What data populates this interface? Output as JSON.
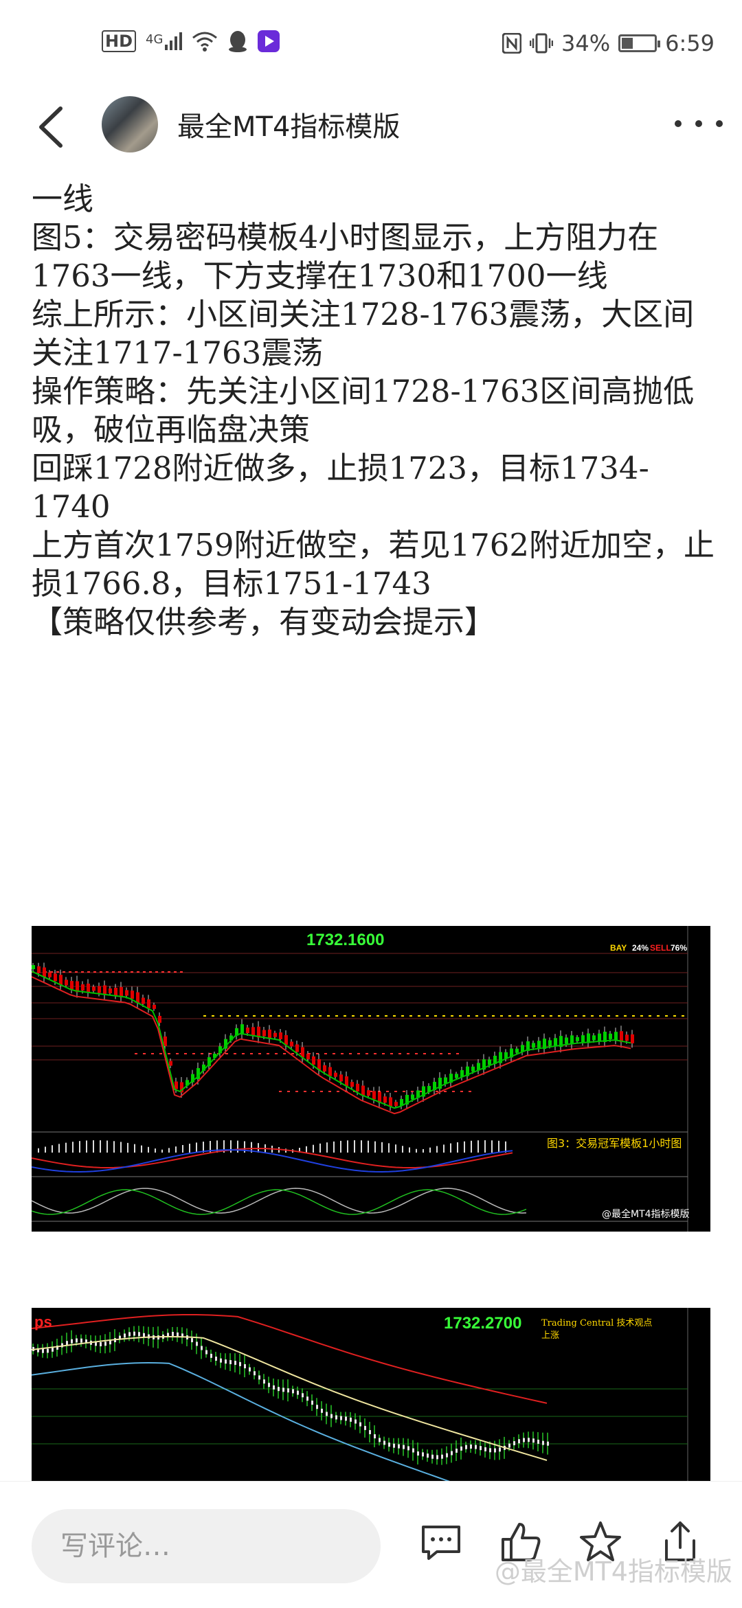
{
  "status_bar": {
    "network": "HD",
    "signal": "4G",
    "battery": "34%",
    "battery_level": 0.34,
    "time": "6:59"
  },
  "header": {
    "title": "最全MT4指标模版"
  },
  "article": {
    "lines": [
      "一线",
      "图5：交易密码模板4小时图显示，上方阻力在1763一线，下方支撑在1730和1700一线",
      "综上所示：小区间关注1728-1763震荡，大区间关注1717-1763震荡",
      "操作策略：先关注小区间1728-1763区间高抛低吸，破位再临盘决策",
      "回踩1728附近做多，止损1723，目标1734-1740",
      "上方首次1759附近做空，若见1762附近加空，止损1766.8，目标1751-1743",
      "【策略仅供参考，有变动会提示】"
    ]
  },
  "chart1": {
    "price": "1732.1600",
    "bay_label": "BAY",
    "bay_pct": "24%",
    "sell_label": "SELL",
    "sell_pct": "76%",
    "caption": "图3：交易冠军模板1小时图",
    "watermark": "@最全MT4指标模版",
    "colors": {
      "bull": "#00d000",
      "bear": "#e00000",
      "price": "#38ff38"
    }
  },
  "chart2": {
    "logo": "ps",
    "price": "1732.2700",
    "tc_title": "Trading Central 技术观点",
    "tc_subtitle": "上涨",
    "colors": {
      "price": "#38ff38",
      "red_line": "#e02020",
      "yellow_line": "#f0e6a0",
      "blue_line": "#5ab0e0"
    }
  },
  "bottom_bar": {
    "comment_placeholder": "写评论…",
    "watermark": "@最全MT4指标模版",
    "icons": [
      "comment-icon",
      "like-icon",
      "favorite-icon",
      "share-icon"
    ]
  }
}
